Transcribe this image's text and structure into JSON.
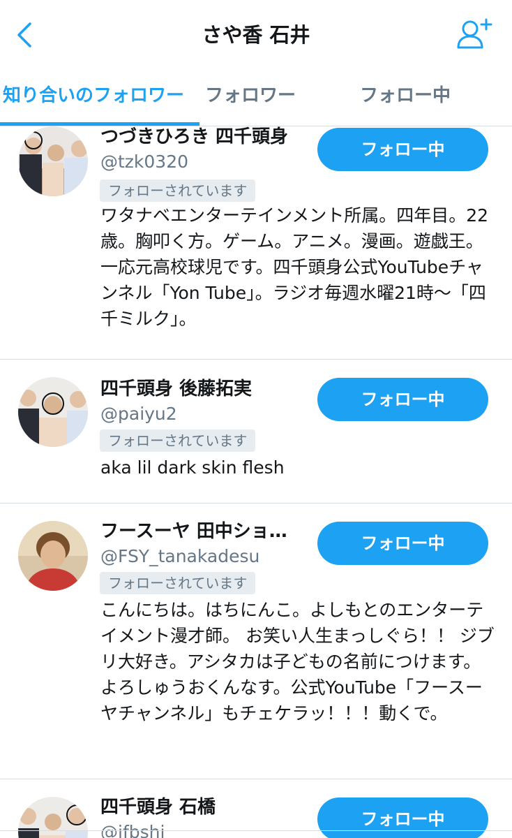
{
  "header": {
    "title": "さや香 石井",
    "back_icon": "chevron-left-icon",
    "add_user_icon": "add-user-icon"
  },
  "tabs": [
    {
      "label": "知り合いのフォロワー",
      "active": true
    },
    {
      "label": "フォロワー",
      "active": false
    },
    {
      "label": "フォロー中",
      "active": false
    }
  ],
  "colors": {
    "accent": "#1da1f2",
    "secondary_text": "#657786",
    "badge_bg": "#e6ecf0"
  },
  "users": [
    {
      "name": "つづきひろき 四千頭身",
      "handle": "@tzk0320",
      "badge": "フォローされています",
      "button": "フォロー中",
      "bio": "ワタナベエンターテインメント所属。四年目。22歳。胸叩く方。ゲーム。アニメ。漫画。遊戯王。一応元高校球児です。四千頭身公式YouTubeチャンネル「Yon Tube」。ラジオ毎週水曜21時〜「四千ミルク」。"
    },
    {
      "name": "四千頭身 後藤拓実",
      "handle": "@paiyu2",
      "badge": "フォローされています",
      "button": "フォロー中",
      "bio": "aka lil dark skin flesh"
    },
    {
      "name": "フースーヤ 田中ショ…",
      "handle": "@FSY_tanakadesu",
      "badge": "フォローされています",
      "button": "フォロー中",
      "bio": "こんにちは。はちにんこ。よしもとのエンターテイメント漫才師。 お笑い人生まっしぐら！！ ジブリ大好き。アシタカは子どもの名前につけます。よろしゅうおくんなす。公式YouTube「フースーヤチャンネル」もチェケラッ！！！動くで。"
    },
    {
      "name": "四千頭身 石橋",
      "handle": "@ifbshi",
      "badge": "",
      "button": "フォロー中",
      "bio": ""
    }
  ]
}
